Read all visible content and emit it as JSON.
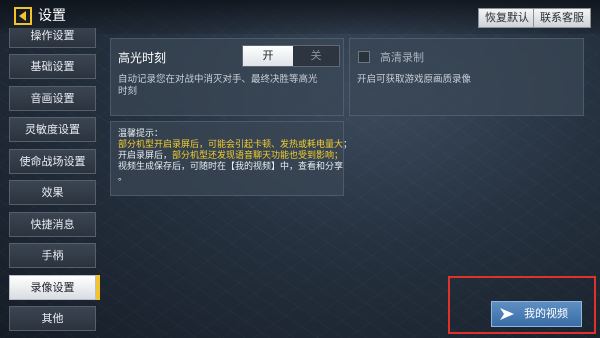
{
  "header": {
    "title": "设置",
    "restore_label": "恢复默认",
    "support_label": "联系客服"
  },
  "sidebar": {
    "items": [
      {
        "label": "操作设置",
        "active": false
      },
      {
        "label": "基础设置",
        "active": false
      },
      {
        "label": "音画设置",
        "active": false
      },
      {
        "label": "灵敏度设置",
        "active": false
      },
      {
        "label": "使命战场设置",
        "active": false
      },
      {
        "label": "效果",
        "active": false
      },
      {
        "label": "快捷消息",
        "active": false
      },
      {
        "label": "手柄",
        "active": false
      },
      {
        "label": "录像设置",
        "active": true
      },
      {
        "label": "其他",
        "active": false
      }
    ]
  },
  "highlight": {
    "title": "高光时刻",
    "toggle_on": "开",
    "toggle_off": "关",
    "desc_line1": "自动记录您在对战中消灭对手、最终决胜等高光",
    "desc_line2": "时刻"
  },
  "hd": {
    "title": "高清录制",
    "desc": "开启可获取游戏原画质录像",
    "checked": false
  },
  "tips": {
    "heading": "温馨提示：",
    "line1": "部分机型开启录屏后，可能会引起卡顿、发热或耗电量大",
    "line1_end": "；",
    "line2_prefix": "开启录屏后，",
    "line2_yellow": "部分机型还发现语音聊天功能也受到影响；",
    "line3": "视频生成保存后，可随时在【我的视频】中，查看和分享",
    "line4": "。"
  },
  "my_video": {
    "label": "我的视频",
    "icon": "play-arrow-icon"
  },
  "colors": {
    "accent": "#f3c32e",
    "tip_yellow": "#f6cf2f",
    "highlight_box": "#e0312b",
    "video_button": "#4a7db5"
  }
}
